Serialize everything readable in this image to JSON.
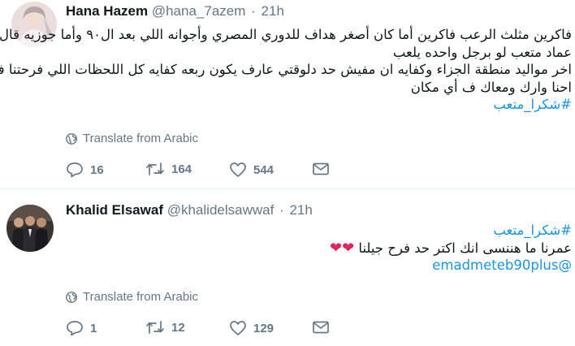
{
  "tweets": [
    {
      "name": "Hana Hazem",
      "handle": "@hana_7azem",
      "separator": "·",
      "time": "21h",
      "lines": [
        "فاكرين مثلث الرعب فاكرين أما كان أصغر هداف للدوري المصري  وأجوانه اللي بعد ال٩٠ وأما جوزيه قال",
        "عماد متعب لو برجل واحده يلعب",
        "اخر مواليد منطقة الجزاء وكفايه ان مفيش حد دلوقتي عارف يكون ربعه كفايه كل اللحظات اللي فرحتنا فيها",
        "احنا وارك ومعاك ف أي مكان"
      ],
      "hashtag": "#شكرا_متعب",
      "translate_label": "Translate from Arabic",
      "stats": {
        "replies": "16",
        "retweets": "164",
        "likes": "544"
      }
    },
    {
      "name": "Khalid Elsawaf",
      "handle": "@khalidelsawwaf",
      "separator": "·",
      "time": "21h",
      "hashtag": "#شكرا_متعب",
      "lines": [
        "عمرنا ما هننسى انك اكتر حد فرح جيلنا"
      ],
      "hearts": "❤❤",
      "mention": "@emadmeteb90plus",
      "translate_label": "Translate from Arabic",
      "stats": {
        "replies": "1",
        "retweets": "12",
        "likes": "129"
      }
    }
  ],
  "icons": {
    "globe": "globe-icon",
    "reply": "reply-icon",
    "retweet": "retweet-icon",
    "like": "heart-icon",
    "message": "envelope-icon"
  },
  "colors": {
    "text": "#14171a",
    "secondary": "#657786",
    "link": "#1b95e0",
    "heart": "#e0245e",
    "divider": "#e6ecf0"
  }
}
